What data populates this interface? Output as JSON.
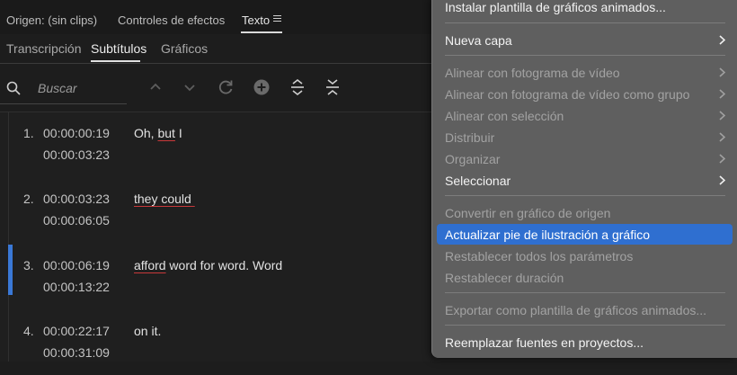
{
  "top_tabs": {
    "source": "Origen: (sin clips)",
    "effects": "Controles de efectos",
    "text": "Texto"
  },
  "sub_tabs": {
    "transcription": "Transcripción",
    "subtitles": "Subtítulos",
    "graphics": "Gráficos"
  },
  "search": {
    "placeholder": "Buscar"
  },
  "captions": [
    {
      "num": "1.",
      "in": "00:00:00:19",
      "out": "00:00:03:23",
      "text_a": "Oh, ",
      "text_b": "but",
      "text_c": " I"
    },
    {
      "num": "2.",
      "in": "00:00:03:23",
      "out": "00:00:06:05",
      "text_a": "",
      "text_b": "they could ",
      "text_c": ""
    },
    {
      "num": "3.",
      "in": "00:00:06:19",
      "out": "00:00:13:22",
      "text_a": "",
      "text_b": "afford",
      "text_c": " word for word. Word"
    },
    {
      "num": "4.",
      "in": "00:00:22:17",
      "out": "00:00:31:09",
      "text_a": "on it.",
      "text_b": "",
      "text_c": ""
    }
  ],
  "menu": {
    "install_template": "Instalar plantilla de gráficos animados...",
    "new_layer": "Nueva capa",
    "align_frame": "Alinear con fotograma de vídeo",
    "align_frame_group": "Alinear con fotograma de vídeo como grupo",
    "align_selection": "Alinear con selección",
    "distribute": "Distribuir",
    "organize": "Organizar",
    "select": "Seleccionar",
    "convert_source": "Convertir en gráfico de origen",
    "update_caption": "Actualizar pie de ilustración a gráfico",
    "reset_params": "Restablecer todos los parámetros",
    "reset_duration": "Restablecer duración",
    "export_template": "Exportar como plantilla de gráficos animados...",
    "replace_fonts": "Reemplazar fuentes en proyectos..."
  },
  "colors": {
    "accent": "#2f6fd0",
    "selection_bar": "#3a78d6",
    "spellcheck": "#c8383a",
    "menu_bg": "#5f5f5f",
    "panel_bg": "#1d1d1d"
  },
  "icons": [
    "search-icon",
    "chevron-up-icon",
    "chevron-down-icon",
    "refresh-icon",
    "add-circle-icon",
    "expand-icon",
    "collapse-icon",
    "hamburger-menu-icon",
    "chevron-right-icon"
  ]
}
